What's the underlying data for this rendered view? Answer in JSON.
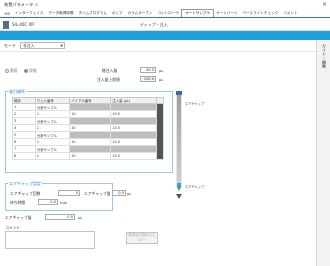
{
  "window": {
    "title": "装置パラメータ"
  },
  "tabs": [
    {
      "label": "MS"
    },
    {
      "label": "インターフェイス"
    },
    {
      "label": "データ取得時間"
    },
    {
      "label": "タイムプログラム"
    },
    {
      "label": "ポンプ"
    },
    {
      "label": "カラムオーブン"
    },
    {
      "label": "コントローラ"
    },
    {
      "label": "オートサンプラ",
      "active": true
    },
    {
      "label": "オートパージ"
    },
    {
      "label": "ベースラインチェック"
    },
    {
      "label": "コメント"
    }
  ],
  "device": {
    "name": "SIL-40C XR",
    "label": "ディップ・注入"
  },
  "mode": {
    "label": "モード",
    "value": "非注入"
  },
  "sidepanel": {
    "label": "ガイド・編集"
  },
  "injection_type": {
    "options": [
      "簡易",
      "詳細"
    ]
  },
  "volume": {
    "inject_label": "総注入量",
    "inject_value": "40.0",
    "inject_unit": "µL",
    "total_label": "注入量上限値",
    "total_value": "100.0",
    "total_unit": "µL"
  },
  "sequence": {
    "title": "吸引順序",
    "columns": [
      "順序",
      "ウェル番号",
      "バイアル番号",
      "注入量 (µL)"
    ],
    "rows": [
      {
        "no": "1",
        "well": "分析サンプル",
        "vial": "",
        "vol": ""
      },
      {
        "no": "2",
        "well": "1",
        "vial": "10",
        "vol": "10.0"
      },
      {
        "no": "3",
        "well": "分析サンプル",
        "vial": "",
        "vol": ""
      },
      {
        "no": "4",
        "well": "1",
        "vial": "10",
        "vol": "10.0"
      },
      {
        "no": "5",
        "well": "分析サンプル",
        "vial": "",
        "vol": ""
      },
      {
        "no": "6",
        "well": "1",
        "vial": "10",
        "vol": "10.0"
      },
      {
        "no": "7",
        "well": "分析サンプル",
        "vial": "",
        "vol": ""
      },
      {
        "no": "8",
        "well": "1",
        "vial": "10",
        "vol": "10.0"
      }
    ]
  },
  "probe": {
    "top_label": "エアギャップ",
    "bottom_label": "エアギャップ"
  },
  "airgap": {
    "title": "エアギャップ設定",
    "count_label": "エアギャップ回数",
    "count_value": "0",
    "wait_label": "待ち時間",
    "wait_value": "0.0",
    "wait_unit": "min",
    "volume_label": "エアギャップ量",
    "volume_value": "0.0",
    "volume_unit": "µL"
  },
  "airgap_vol": {
    "label": "エアギャップ量",
    "value": "0.0",
    "unit": "µL"
  },
  "comment": {
    "label": "コメント",
    "value": ""
  },
  "copy_button": {
    "label": "簡易吸引順序からコピー"
  }
}
